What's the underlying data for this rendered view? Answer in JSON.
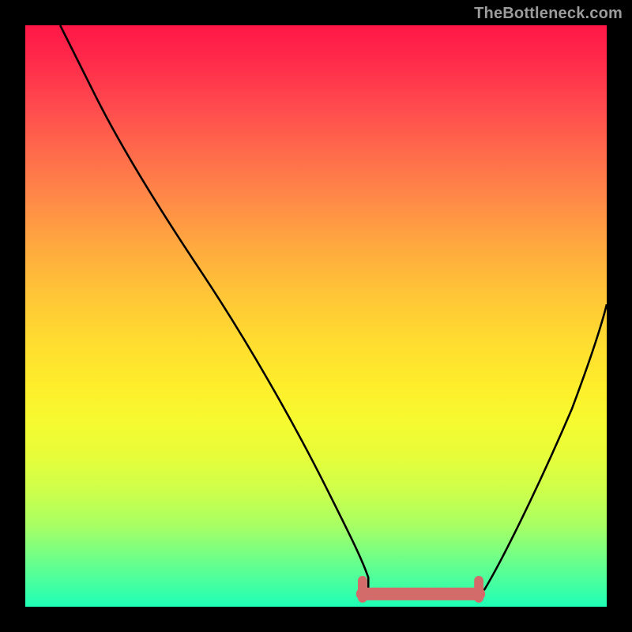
{
  "watermark": "TheBottleneck.com",
  "colors": {
    "frame_bg": "#000000",
    "curve": "#000000",
    "bottom_marker": "#d36b6b"
  },
  "chart_data": {
    "type": "line",
    "xlim": [
      0,
      100
    ],
    "ylim": [
      0,
      100
    ],
    "title": "",
    "xlabel": "",
    "ylabel": "",
    "series": [
      {
        "name": "bottleneck-curve",
        "x": [
          6,
          8,
          12,
          18,
          26,
          34,
          42,
          50,
          54,
          58,
          60,
          62,
          66,
          70,
          74,
          78,
          82,
          86,
          90,
          94,
          98,
          100
        ],
        "y": [
          100,
          96,
          88,
          78,
          64,
          51,
          38,
          24,
          16,
          8,
          4,
          2,
          2,
          2,
          2,
          4,
          8,
          16,
          26,
          36,
          46,
          52
        ]
      }
    ],
    "annotations": [
      {
        "name": "optimal-range-marker",
        "type": "segment",
        "x": [
          58,
          78
        ],
        "y": [
          2,
          2
        ]
      }
    ]
  }
}
